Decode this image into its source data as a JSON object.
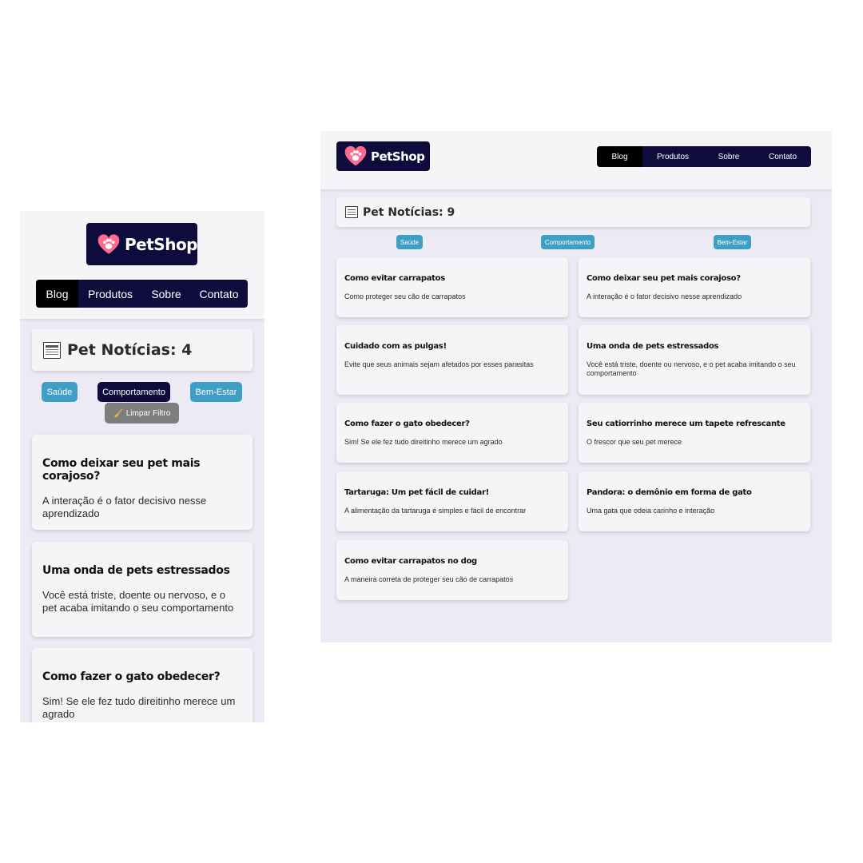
{
  "brand": {
    "name": "PetShop",
    "logo_color": "#0f0c3d",
    "heart_color": "#ff6b8f"
  },
  "nav": {
    "items": [
      "Blog",
      "Produtos",
      "Sobre",
      "Contato"
    ],
    "active": "Blog"
  },
  "mobile": {
    "heading": "Pet Notícias: 4",
    "filters": {
      "health": "Saúde",
      "behavior": "Comportamento",
      "wellness": "Bem-Estar",
      "clear": "Limpar Filtro",
      "active": "Comportamento"
    },
    "posts": [
      {
        "title": "Como deixar seu pet mais corajoso?",
        "description": "A interação é o fator decisivo nesse aprendizado"
      },
      {
        "title": "Uma onda de pets estressados",
        "description": "Você está triste, doente ou nervoso, e o pet acaba imitando o seu comportamento"
      },
      {
        "title": "Como fazer o gato obedecer?",
        "description": "Sim! Se ele fez tudo direitinho merece um agrado"
      }
    ]
  },
  "desktop": {
    "heading": "Pet Notícias: 9",
    "filters": {
      "health": "Saúde",
      "behavior": "Comportamento",
      "wellness": "Bem-Estar"
    },
    "posts": [
      {
        "title": "Como evitar carrapatos",
        "description": "Como proteger seu cão de carrapatos"
      },
      {
        "title": "Como deixar seu pet mais corajoso?",
        "description": "A interação é o fator decisivo nesse aprendizado"
      },
      {
        "title": "Cuidado com as pulgas!",
        "description": "Evite que seus animais sejam afetados por esses parasitas"
      },
      {
        "title": "Uma onda de pets estressados",
        "description": "Você está triste, doente ou nervoso, e o pet acaba imitando o seu comportamento"
      },
      {
        "title": "Como fazer o gato obedecer?",
        "description": "Sim! Se ele fez tudo direitinho merece um agrado"
      },
      {
        "title": "Seu catiorrinho merece um tapete refrescante",
        "description": "O frescor que seu pet merece"
      },
      {
        "title": "Tartaruga: Um pet fácil de cuidar!",
        "description": "A alimentação da tartaruga é simples e fácil de encontrar"
      },
      {
        "title": "Pandora: o demônio em forma de gato",
        "description": "Uma gata que odeia carinho e interação"
      },
      {
        "title": "Como evitar carrapatos no dog",
        "description": "A maneira correta de proteger seu cão de carrapatos"
      }
    ]
  },
  "colors": {
    "panel_bg": "#ecebf5",
    "header_bg": "#f5f5f7",
    "filter_blue": "#3f9ec4",
    "nav_active": "#000000",
    "clear_filter": "#7d7d7d"
  }
}
